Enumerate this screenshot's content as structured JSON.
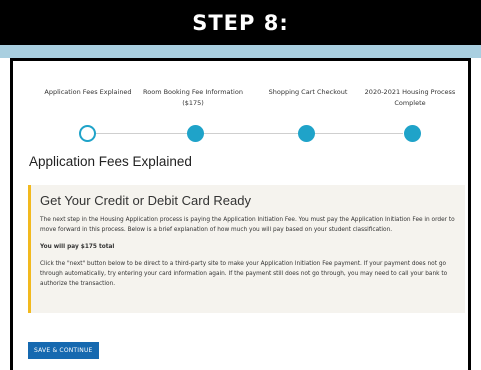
{
  "banner": {
    "title": "STEP 8:",
    "colors": {
      "background": "#000000",
      "accent_bar": "#a9cfe0"
    }
  },
  "stepper": {
    "steps": [
      {
        "label": "Application Fees Explained",
        "state": "current"
      },
      {
        "label": "Room Booking Fee Information ($175)",
        "state": "upcoming"
      },
      {
        "label": "Shopping Cart Checkout",
        "state": "upcoming"
      },
      {
        "label": "2020-2021 Housing Process Complete",
        "state": "upcoming"
      }
    ],
    "color": "#1fa3c9"
  },
  "page": {
    "title": "Application Fees Explained"
  },
  "info": {
    "heading": "Get Your Credit or Debit Card Ready",
    "paragraph1": "The next step in the Housing Application process is paying the Application Initiation Fee. You must pay the Application Initiation Fee in order to move forward in this process. Below is a brief explanation of how much you will pay based on your student classification.",
    "paragraph2": "You will pay $175 total",
    "paragraph3": "Click the \"next\" button below to be direct to a third-party site to make your Application Initiation Fee payment. If your payment does not go through automatically, try entering your card information again. If the payment still does not go through, you may need to call your bank to authorize the transaction.",
    "accent_color": "#f2b91e"
  },
  "actions": {
    "save_continue_label": "SAVE & CONTINUE",
    "button_color": "#1669b0"
  }
}
